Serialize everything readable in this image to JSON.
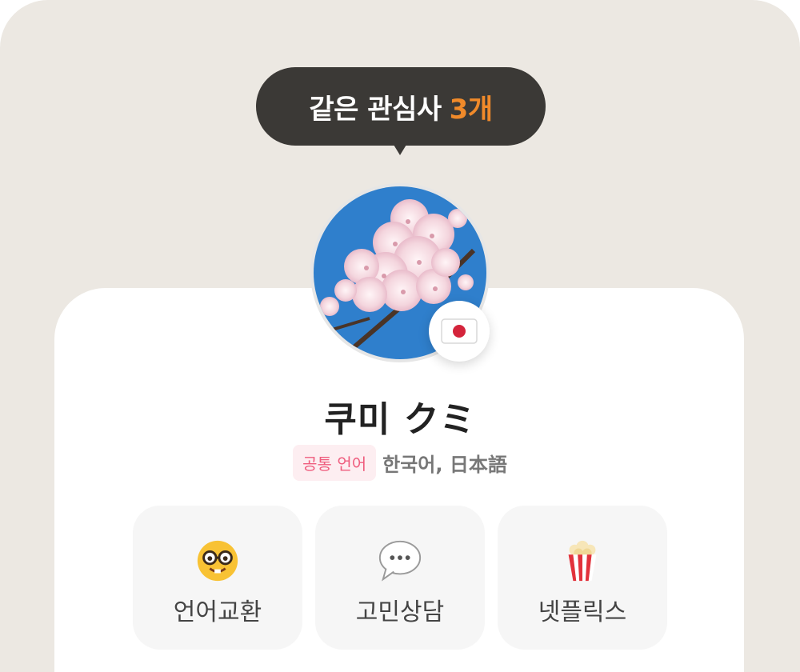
{
  "badge": {
    "text": "같은 관심사",
    "count": "3개",
    "accent_color": "#f08a2a"
  },
  "profile": {
    "name": "쿠미 クミ",
    "avatar": "cherry-blossom-photo",
    "flag": "japan-flag-icon"
  },
  "languages": {
    "label": "공통 언어",
    "value": "한국어, 日本語"
  },
  "interests": [
    {
      "icon": "nerd-face-icon",
      "label": "언어교환"
    },
    {
      "icon": "speech-bubble-icon",
      "label": "고민상담"
    },
    {
      "icon": "popcorn-icon",
      "label": "넷플릭스"
    }
  ]
}
